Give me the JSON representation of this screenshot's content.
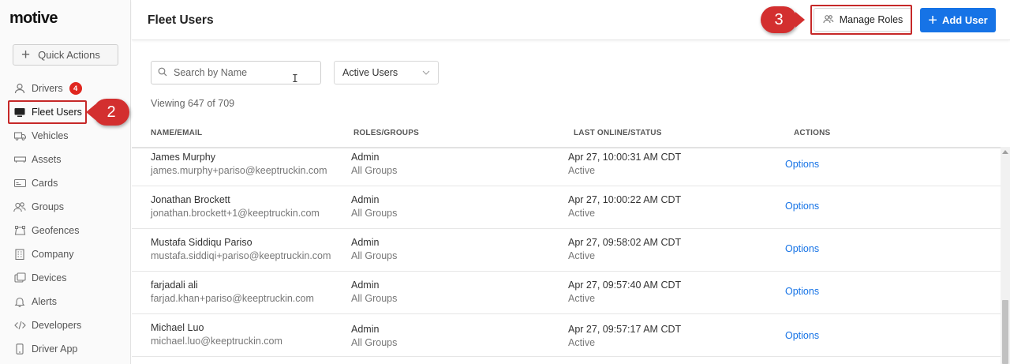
{
  "app": {
    "logo_text": "motive"
  },
  "sidebar": {
    "quick_actions_label": "Quick Actions",
    "items": [
      {
        "label": "Drivers",
        "icon": "person-icon",
        "badge": "4"
      },
      {
        "label": "Fleet Users",
        "icon": "monitor-icon",
        "active": true
      },
      {
        "label": "Vehicles",
        "icon": "truck-icon"
      },
      {
        "label": "Assets",
        "icon": "trailer-icon"
      },
      {
        "label": "Cards",
        "icon": "card-icon"
      },
      {
        "label": "Groups",
        "icon": "groups-icon"
      },
      {
        "label": "Geofences",
        "icon": "geofence-icon"
      },
      {
        "label": "Company",
        "icon": "building-icon"
      },
      {
        "label": "Devices",
        "icon": "devices-icon"
      },
      {
        "label": "Alerts",
        "icon": "bell-icon"
      },
      {
        "label": "Developers",
        "icon": "code-icon"
      },
      {
        "label": "Driver App",
        "icon": "phone-icon"
      }
    ]
  },
  "callouts": {
    "fleet_users_step": "2",
    "manage_roles_step": "3"
  },
  "header": {
    "title": "Fleet Users",
    "manage_roles_label": "Manage Roles",
    "add_user_label": "Add User"
  },
  "filters": {
    "search_placeholder": "Search by Name",
    "status_selected": "Active Users"
  },
  "viewing_text": "Viewing 647 of 709",
  "table": {
    "headers": [
      "NAME/EMAIL",
      "ROLES/GROUPS",
      "LAST ONLINE/STATUS",
      "ACTIONS"
    ],
    "rows": [
      {
        "name": "James Murphy",
        "email": "james.murphy+pariso@keeptruckin.com",
        "role": "Admin",
        "group": "All Groups",
        "last_online": "Apr 27, 10:00:31 AM CDT",
        "status": "Active",
        "action": "Options"
      },
      {
        "name": "Jonathan Brockett",
        "email": "jonathan.brockett+1@keeptruckin.com",
        "role": "Admin",
        "group": "All Groups",
        "last_online": "Apr 27, 10:00:22 AM CDT",
        "status": "Active",
        "action": "Options"
      },
      {
        "name": "Mustafa Siddiqu Pariso",
        "email": "mustafa.siddiqi+pariso@keeptruckin.com",
        "role": "Admin",
        "group": "All Groups",
        "last_online": "Apr 27, 09:58:02 AM CDT",
        "status": "Active",
        "action": "Options"
      },
      {
        "name": "farjadali ali",
        "email": "farjad.khan+pariso@keeptruckin.com",
        "role": "Admin",
        "group": "All Groups",
        "last_online": "Apr 27, 09:57:40 AM CDT",
        "status": "Active",
        "action": "Options"
      },
      {
        "name": "Michael Luo",
        "email": "michael.luo@keeptruckin.com",
        "role": "Admin",
        "group": "All Groups",
        "last_online": "Apr 27, 09:57:17 AM CDT",
        "status": "Active",
        "action": "Options"
      }
    ]
  },
  "colors": {
    "accent": "#1673e6",
    "highlight": "#d32f2f",
    "badge": "#e0261f"
  }
}
